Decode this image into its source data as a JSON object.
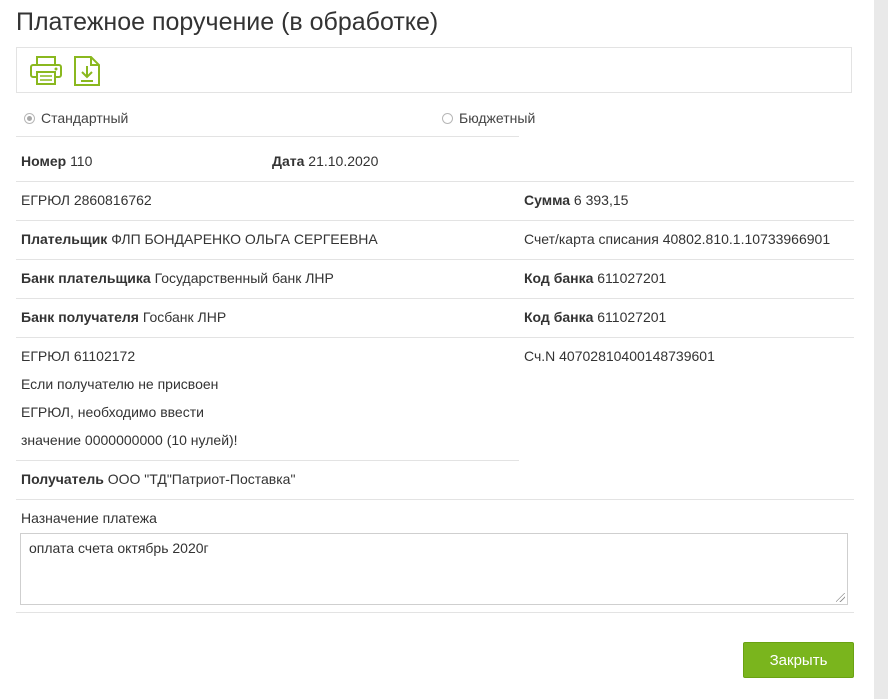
{
  "title": "Платежное поручение (в обработке)",
  "toolbar": {
    "print_icon": "printer-icon",
    "download_icon": "download-icon"
  },
  "type": {
    "standard_label": "Стандартный",
    "budget_label": "Бюджетный",
    "selected": "Стандартный"
  },
  "number": {
    "label": "Номер",
    "value": "110"
  },
  "date": {
    "label": "Дата",
    "value": "21.10.2020"
  },
  "payer_egrul": "ЕГРЮЛ 2860816762",
  "amount": {
    "label": "Сумма",
    "value": "6 393,15"
  },
  "payer": {
    "label": "Плательщик",
    "value": "ФЛП БОНДАРЕНКО ОЛЬГА СЕРГЕЕВНА"
  },
  "account": {
    "label": "Счет/карта списания",
    "value": "40802.810.1.10733966901"
  },
  "payer_bank": {
    "label": "Банк плательщика",
    "value": "Государственный банк ЛНР",
    "code_label": "Код банка",
    "code": "611027201"
  },
  "recipient_bank": {
    "label": "Банк получателя",
    "value": "Госбанк ЛНР",
    "code_label": "Код банка",
    "code": "611027201"
  },
  "recipient_egrul": "ЕГРЮЛ 61102172",
  "egrul_note": [
    "Если получателю не присвоен",
    "ЕГРЮЛ, необходимо ввести",
    "значение 0000000000 (10 нулей)!"
  ],
  "recipient_account": "Сч.N 40702810400148739601",
  "recipient": {
    "label": "Получатель",
    "value": "ООО \"ТД\"Патриот-Поставка\""
  },
  "purpose": {
    "label": "Назначение платежа",
    "value": "оплата счета октябрь 2020г"
  },
  "close_label": "Закрыть",
  "colors": {
    "accent_green": "#7ab51d",
    "icon_green": "#8ab81f"
  }
}
